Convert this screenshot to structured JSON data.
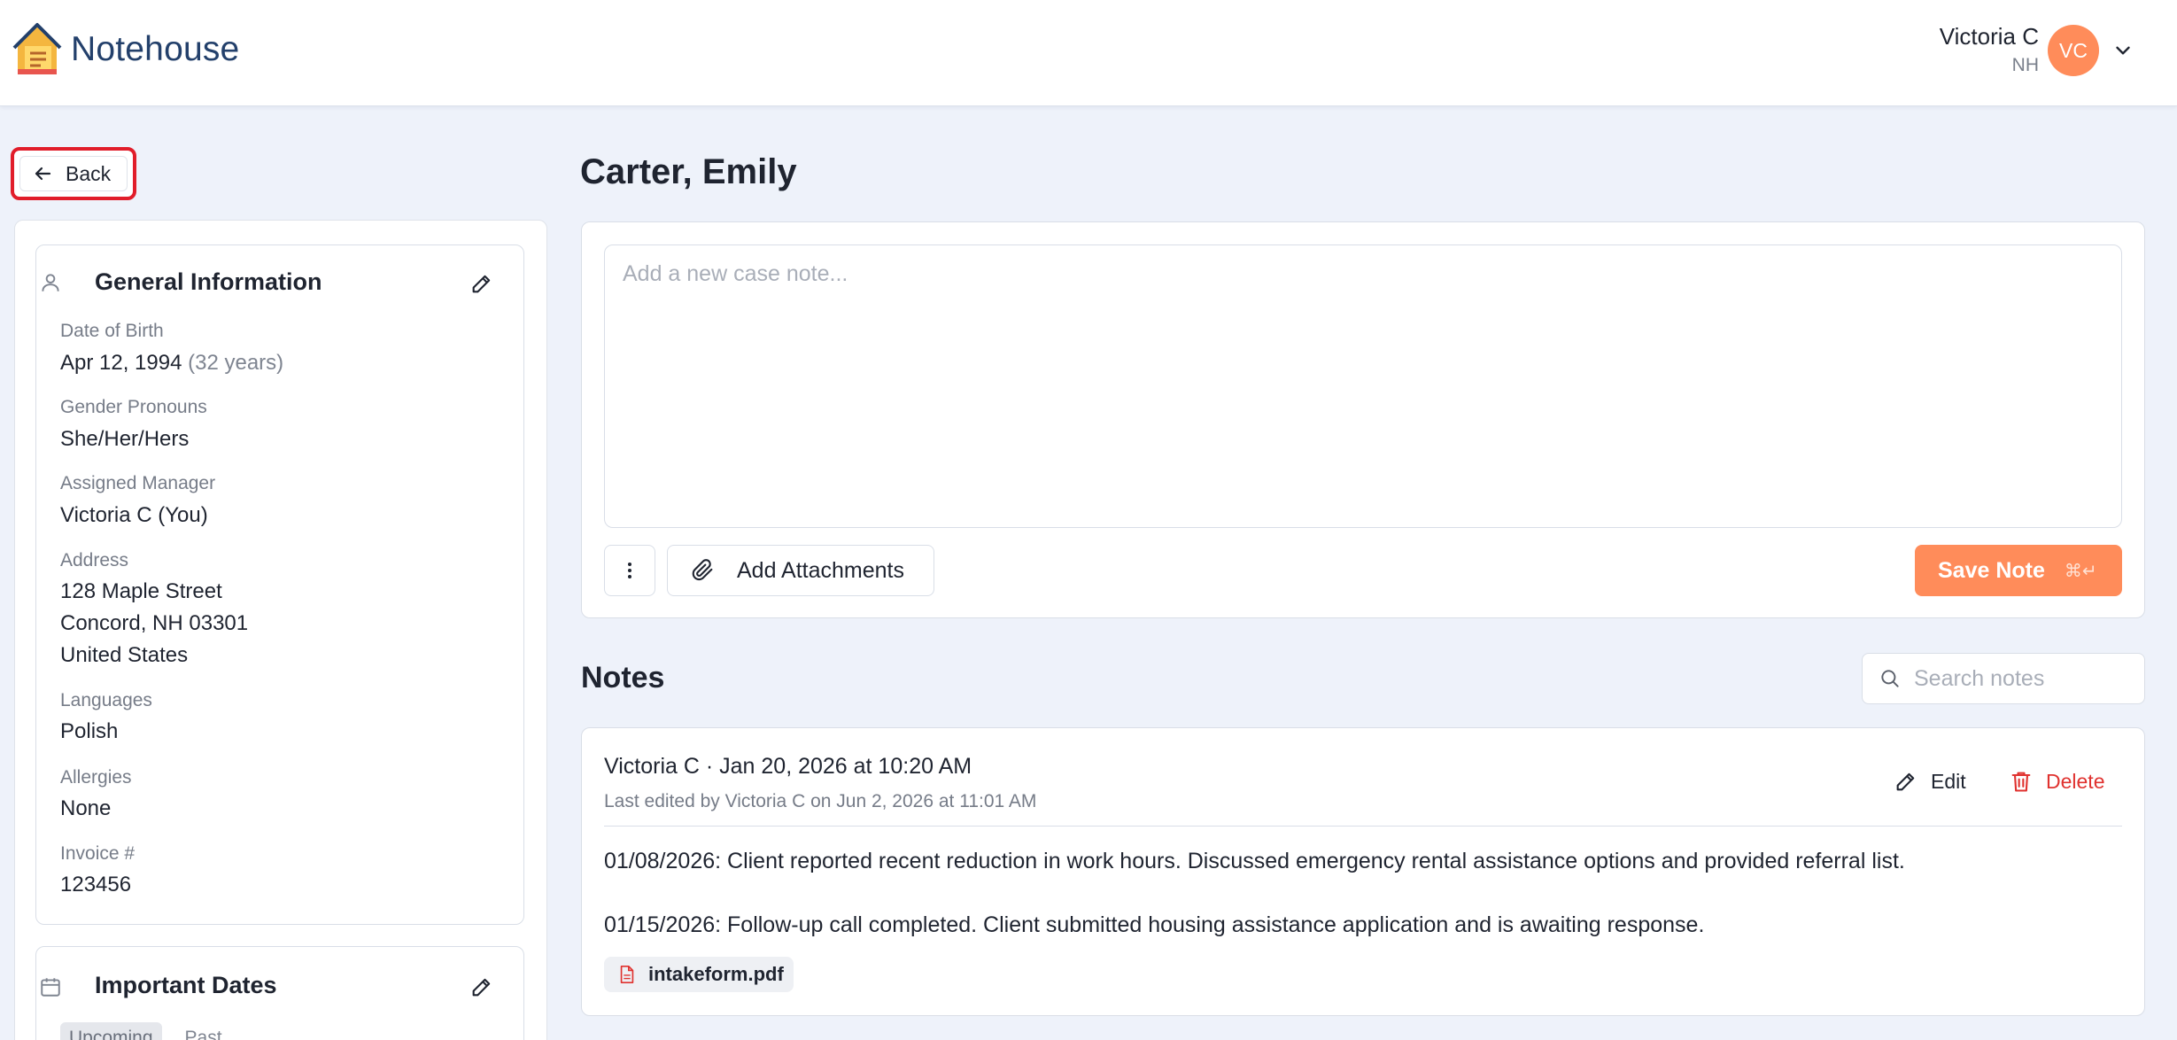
{
  "app": {
    "brand": "Notehouse",
    "accent_color": "#ff8c5a",
    "danger_color": "#e0322f"
  },
  "user": {
    "name": "Victoria C",
    "org": "NH",
    "initials": "VC"
  },
  "nav": {
    "back_label": "Back"
  },
  "client": {
    "name": "Carter, Emily"
  },
  "general_info": {
    "title": "General Information",
    "fields": [
      {
        "label": "Date of Birth",
        "value": "Apr 12, 1994",
        "extra": "(32 years)"
      },
      {
        "label": "Gender Pronouns",
        "value": "She/Her/Hers"
      },
      {
        "label": "Assigned Manager",
        "value": "Victoria C (You)"
      },
      {
        "label": "Address",
        "lines": [
          "128 Maple Street",
          "Concord, NH 03301",
          "United States"
        ]
      },
      {
        "label": "Languages",
        "value": "Polish"
      },
      {
        "label": "Allergies",
        "value": "None"
      },
      {
        "label": "Invoice #",
        "value": "123456"
      }
    ]
  },
  "important_dates": {
    "title": "Important Dates",
    "tabs": [
      "Upcoming",
      "Past"
    ]
  },
  "compose": {
    "placeholder": "Add a new case note...",
    "attach_label": "Add Attachments",
    "save_label": "Save Note",
    "save_shortcut": "⌘↵"
  },
  "notes": {
    "heading": "Notes",
    "search_placeholder": "Search notes",
    "items": [
      {
        "author_line": "Victoria C · Jan 20, 2026 at 10:20 AM",
        "edited_line": "Last edited by Victoria C on Jun 2, 2026 at 11:01 AM",
        "edit_label": "Edit",
        "delete_label": "Delete",
        "body": [
          "01/08/2026: Client reported recent reduction in work hours. Discussed emergency rental assistance options and provided referral list.",
          "01/15/2026: Follow-up call completed. Client submitted housing assistance application and is awaiting response."
        ],
        "attachment": "intakeform.pdf"
      }
    ]
  }
}
